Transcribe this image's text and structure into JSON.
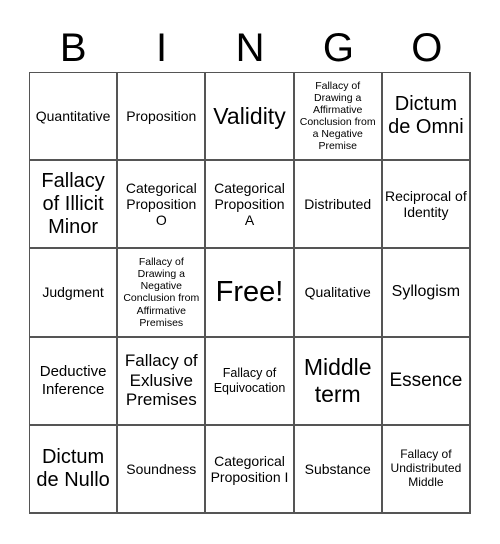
{
  "header": [
    "B",
    "I",
    "N",
    "G",
    "O"
  ],
  "cells": [
    {
      "text": "Quantitative",
      "size": "md"
    },
    {
      "text": "Proposition",
      "size": "md"
    },
    {
      "text": "Validity",
      "size": "xl-l"
    },
    {
      "text": "Fallacy of Drawing a Affirmative Conclusion from a Negative Premise",
      "size": "xs"
    },
    {
      "text": "Dictum de Omni",
      "size": "lg"
    },
    {
      "text": "Fallacy of Illicit Minor",
      "size": "lg"
    },
    {
      "text": "Categorical Proposition O",
      "size": "md"
    },
    {
      "text": "Categorical Proposition A",
      "size": "md"
    },
    {
      "text": "Distributed",
      "size": "md"
    },
    {
      "text": "Reciprocal of Identity",
      "size": "md"
    },
    {
      "text": "Judgment",
      "size": "md"
    },
    {
      "text": "Fallacy of Drawing a Negative Conclusion from Affirmative Premises",
      "size": "xs"
    },
    {
      "text": "Free!",
      "size": "xl"
    },
    {
      "text": "Qualitative",
      "size": "md"
    },
    {
      "text": "Syllogism",
      "size": "md-l"
    },
    {
      "text": "Deductive Inference",
      "size": "md"
    },
    {
      "text": "Fallacy of Exlusive Premises",
      "size": "lg-s"
    },
    {
      "text": "Fallacy of Equivocation",
      "size": "sm"
    },
    {
      "text": "Middle term",
      "size": "xl-m"
    },
    {
      "text": "Essence",
      "size": "lg"
    },
    {
      "text": "Dictum de Nullo",
      "size": "lg"
    },
    {
      "text": "Soundness",
      "size": "md"
    },
    {
      "text": "Categorical Proposition I",
      "size": "md"
    },
    {
      "text": "Substance",
      "size": "md"
    },
    {
      "text": "Fallacy of Undistributed Middle",
      "size": "sm"
    }
  ]
}
